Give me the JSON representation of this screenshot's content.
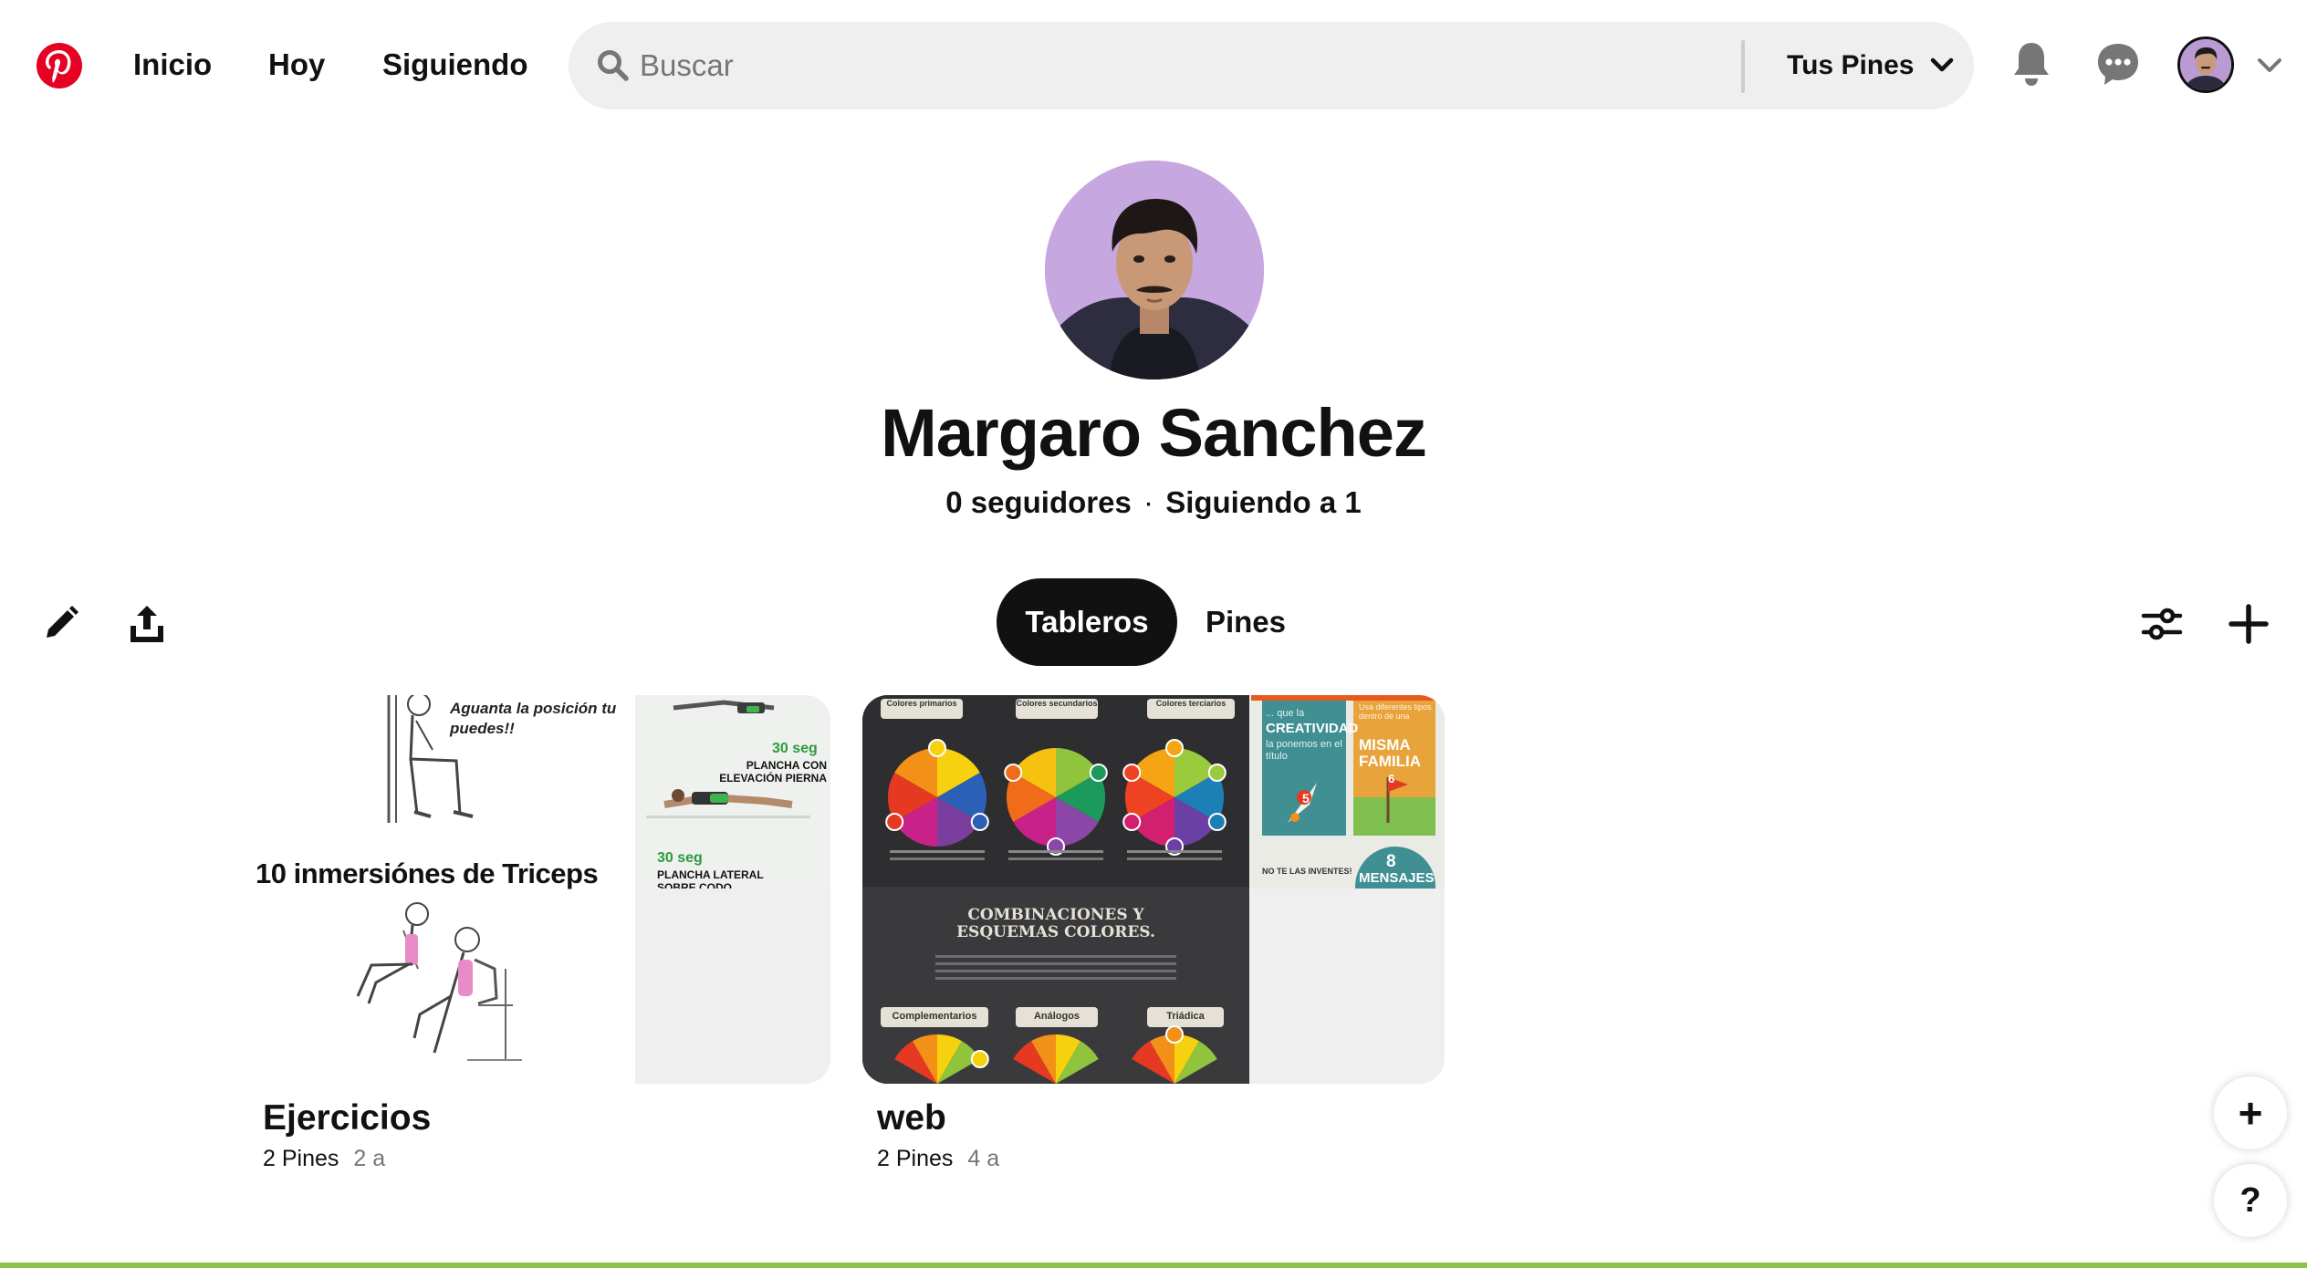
{
  "header": {
    "nav": [
      {
        "label": "Inicio"
      },
      {
        "label": "Hoy"
      },
      {
        "label": "Siguiendo"
      }
    ],
    "search": {
      "placeholder": "Buscar",
      "value": "",
      "scope_label": "Tus Pines"
    },
    "icons": [
      "pinterest-logo",
      "search-icon",
      "chevron-down-icon",
      "bell-icon",
      "chat-icon",
      "avatar",
      "chevron-down-icon"
    ]
  },
  "profile": {
    "name": "Margaro Sanchez",
    "followers": "0 seguidores",
    "separator": "·",
    "following": "Siguiendo a 1"
  },
  "tabs": [
    {
      "label": "Tableros",
      "active": true
    },
    {
      "label": "Pines",
      "active": false
    }
  ],
  "boards": [
    {
      "title": "Ejercicios",
      "pins": "2 Pines",
      "age": "2 a",
      "cover_text": {
        "caption": "Aguanta la posición tu puedes!!",
        "heading": "10 inmersiónes de Triceps",
        "side_1_time": "30 seg",
        "side_1_label": "PLANCHA CON ELEVACIÓN PIERNA",
        "side_2_time": "30 seg",
        "side_2_label": "PLANCHA LATERAL SOBRE CODO"
      }
    },
    {
      "title": "web",
      "pins": "2 Pines",
      "age": "4 a",
      "cover_text": {
        "wheel_1": "Colores primarios",
        "wheel_2": "Colores secundarios",
        "wheel_3": "Colores terciarios",
        "heading": "COMBINACIONES Y ESQUEMAS COLORES.",
        "scheme_1": "Complementarios",
        "scheme_2": "Análogos",
        "scheme_3": "Triádica",
        "side_intro": "... que la",
        "side_word": "CREATIVIDAD",
        "side_rest": "la ponemos en el título",
        "side_small": "Usa diferentes tipos dentro de una",
        "side_family": "MISMA FAMILIA",
        "side_num_5": "5",
        "side_num_6": "6",
        "side_num_8": "8",
        "side_msg": "MENSAJES",
        "side_warn": "NO TE LAS INVENTES!"
      }
    }
  ],
  "floating": {
    "add_label": "+",
    "help_label": "?"
  },
  "colors": {
    "brand": "#e60023",
    "text": "#111111",
    "muted": "#767676",
    "search_bg": "#efefef"
  }
}
